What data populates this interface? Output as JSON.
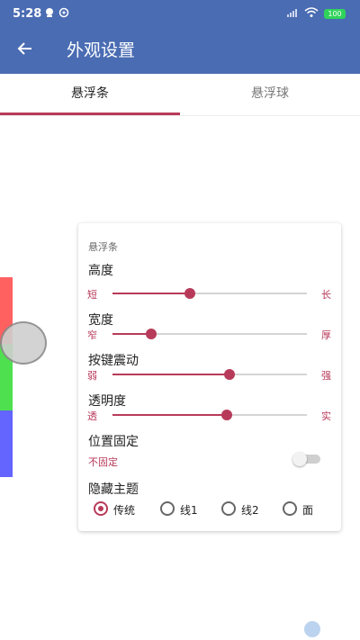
{
  "status_bar": {
    "time": "5:28",
    "battery": "100",
    "icons": [
      "notification-icon",
      "sync-icon",
      "signal-icon",
      "wifi-icon",
      "battery-icon"
    ]
  },
  "app_bar": {
    "title": "外观设置",
    "back_icon": "arrow-left-icon"
  },
  "tabs": [
    {
      "label": "悬浮条",
      "active": true
    },
    {
      "label": "悬浮球",
      "active": false
    }
  ],
  "card": {
    "header": "悬浮条",
    "height": {
      "label": "高度",
      "min": "短",
      "max": "长",
      "value": 0.4
    },
    "width": {
      "label": "宽度",
      "min": "窄",
      "max": "厚",
      "value": 0.2
    },
    "vibration": {
      "label": "按键震动",
      "min": "弱",
      "max": "强",
      "value": 0.6
    },
    "opacity": {
      "label": "透明度",
      "min": "透",
      "max": "实",
      "value": 0.59
    },
    "fixed_position": {
      "label": "位置固定",
      "status": "不固定",
      "on": false
    },
    "theme": {
      "label": "隐藏主题",
      "options": [
        "传统",
        "线1",
        "线2",
        "面"
      ],
      "selected": "传统"
    }
  },
  "colors": {
    "primary": "#4a6cb3",
    "accent": "#b83a5a",
    "preview_red": "#ff6060",
    "preview_green": "#4fe04f",
    "preview_blue": "#6464ff"
  }
}
